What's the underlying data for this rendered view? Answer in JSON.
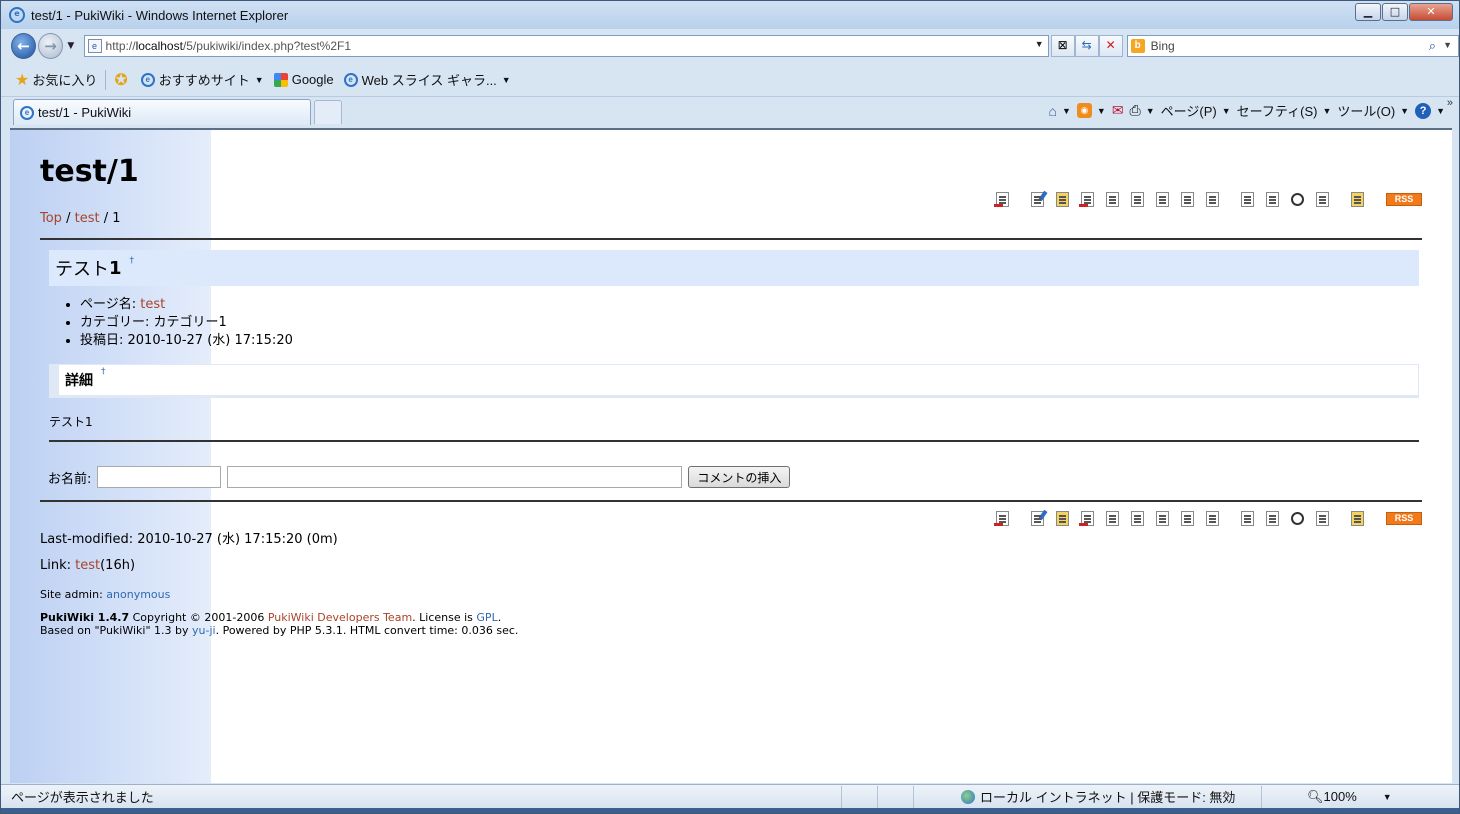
{
  "window": {
    "title": "test/1 - PukiWiki - Windows Internet Explorer",
    "min": "▁",
    "max": "□",
    "close": "✕"
  },
  "address": {
    "url_prefix": "http://",
    "url_host": "localhost",
    "url_path": "/5/pukiwiki/index.php?test%2F1",
    "search_placeholder": "Bing",
    "back_icon": "back-arrow-icon",
    "forward_icon": "forward-arrow-icon"
  },
  "favorites": {
    "label": "お気に入り",
    "items": [
      "おすすめサイト",
      "Google",
      "Web スライス ギャラ..."
    ]
  },
  "tab": {
    "label": "test/1 - PukiWiki"
  },
  "commandbar": {
    "page": "ページ(P)",
    "safety": "セーフティ(S)",
    "tools": "ツール(O)"
  },
  "page": {
    "title": "test/1",
    "breadcrumb": {
      "top": "Top",
      "sep1": " / ",
      "test": "test",
      "sep2": " / ",
      "current": "1"
    },
    "rss": "RSS",
    "h2_prefix": "テスト",
    "h2_number": "1",
    "anchor": "†",
    "info": {
      "page_label": "ページ名: ",
      "page_link": "test",
      "category": "カテゴリー: カテゴリー1",
      "date": "投稿日: 2010-10-27 (水) 17:15:20"
    },
    "h3": "詳細",
    "body": "テスト1",
    "comment": {
      "name_label": "お名前:",
      "name_value": "",
      "msg_value": "",
      "submit": "コメントの挿入"
    },
    "last_modified": "Last-modified: 2010-10-27 (水) 17:15:20 (0m)",
    "link_label": "Link: ",
    "link_page": "test",
    "link_age": "(16h)",
    "site_admin_label": "Site admin: ",
    "site_admin": "anonymous",
    "footer": {
      "product": "PukiWiki 1.4.7",
      "copyright": " Copyright © 2001-2006 ",
      "team": "PukiWiki Developers Team",
      "license": ". License is ",
      "gpl": "GPL",
      "dot": ".",
      "based_on": "Based on \"PukiWiki\" 1.3 by ",
      "author": "yu-ji",
      "powered": ". Powered by PHP 5.3.1. HTML convert time: 0.036 sec."
    }
  },
  "status": {
    "text": "ページが表示されました",
    "zone": "ローカル イントラネット | 保護モード: 無効",
    "zoom": "100%"
  }
}
